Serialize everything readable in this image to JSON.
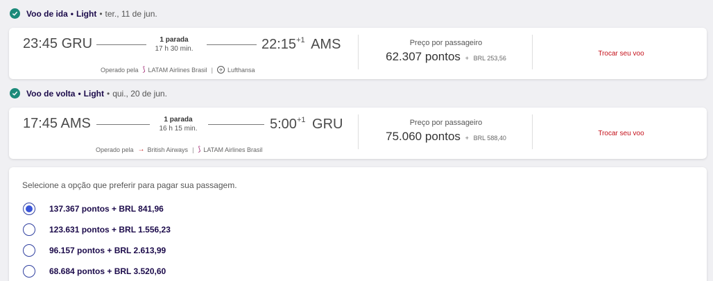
{
  "outbound": {
    "title": "Voo de ida",
    "fare": "Light",
    "date": "ter., 11 de jun.",
    "dep_time": "23:45",
    "dep_airport": "GRU",
    "stops": "1 parada",
    "duration": "17 h 30 min.",
    "arr_time": "22:15",
    "arr_offset": "+1",
    "arr_airport": "AMS",
    "operated_label": "Operado pela",
    "airline_1": "LATAM Airlines Brasil",
    "airline_2": "Lufthansa",
    "price_label": "Preço por passageiro",
    "price_points": "62.307 pontos",
    "price_plus": "+",
    "price_brl": "BRL 253,56",
    "change_label": "Trocar seu voo"
  },
  "inbound": {
    "title": "Voo de volta",
    "fare": "Light",
    "date": "qui., 20 de jun.",
    "dep_time": "17:45",
    "dep_airport": "AMS",
    "stops": "1 parada",
    "duration": "16 h 15 min.",
    "arr_time": "5:00",
    "arr_offset": "+1",
    "arr_airport": "GRU",
    "operated_label": "Operado pela",
    "airline_1": "British Airways",
    "airline_2": "LATAM Airlines Brasil",
    "price_label": "Preço por passageiro",
    "price_points": "75.060 pontos",
    "price_plus": "+",
    "price_brl": "BRL 588,40",
    "change_label": "Trocar seu voo"
  },
  "payment": {
    "title": "Selecione a opção que preferir para pagar sua passagem.",
    "options": [
      {
        "label": "137.367 pontos + BRL 841,96",
        "selected": true
      },
      {
        "label": "123.631 pontos + BRL 1.556,23",
        "selected": false
      },
      {
        "label": "96.157 pontos + BRL 2.613,99",
        "selected": false
      },
      {
        "label": "68.684 pontos + BRL 3.520,60",
        "selected": false
      }
    ]
  },
  "colors": {
    "check": "#1b8a7a",
    "accent_red": "#c4101a",
    "radio_selected": "#3a55d8",
    "heading": "#1b0a4a"
  },
  "icons": {
    "section_status": "check-circle-icon",
    "latam": "latam-logo-icon",
    "lufthansa": "lufthansa-logo-icon",
    "british_airways": "british-airways-logo-icon"
  }
}
